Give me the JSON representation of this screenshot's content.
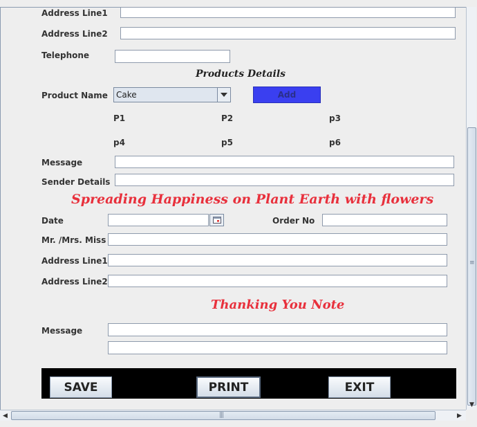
{
  "customer": {
    "address_line1_label": "Address Line1",
    "address_line2_label": "Address Line2",
    "telephone_label": "Telephone"
  },
  "products": {
    "title": "Products Details",
    "product_name_label": "Product Name",
    "selected_product": "Cake",
    "add_label": "Add",
    "items": [
      "P1",
      "P2",
      "p3",
      "p4",
      "p5",
      "p6"
    ]
  },
  "message_label": "Message",
  "sender_details_label": "Sender Details",
  "tagline": "Spreading Happiness on Plant Earth with flowers",
  "recipient": {
    "date_label": "Date",
    "order_no_label": "Order No",
    "name_label": "Mr. /Mrs. Miss",
    "address_line1_label": "Address Line1",
    "address_line2_label": "Address Line2"
  },
  "thank_you": {
    "title": "Thanking You Note",
    "message_label": "Message"
  },
  "actions": {
    "save": "SAVE",
    "print": "PRINT",
    "exit": "EXIT"
  },
  "scrollbars": {
    "up": "▲",
    "down": "▼",
    "left": "◀",
    "right": "▶",
    "grip_v": "≡",
    "grip_h": "|||"
  },
  "colors": {
    "accent_red": "#e8303c",
    "add_button": "#3a3ff0",
    "action_bar": "#000000"
  }
}
